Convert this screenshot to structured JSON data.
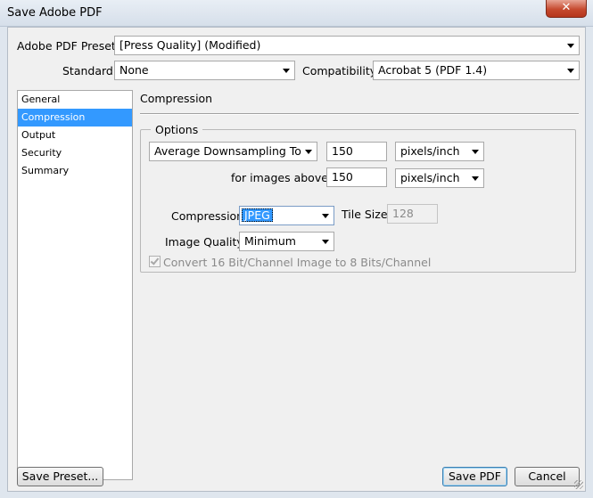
{
  "window": {
    "title": "Save Adobe PDF",
    "close_glyph": "✕"
  },
  "preset": {
    "label": "Adobe PDF Preset:",
    "value": "[Press Quality] (Modified)"
  },
  "standard": {
    "label": "Standard:",
    "value": "None"
  },
  "compatibility": {
    "label": "Compatibility:",
    "value": "Acrobat 5 (PDF 1.4)"
  },
  "sidebar": {
    "items": [
      {
        "label": "General",
        "selected": false
      },
      {
        "label": "Compression",
        "selected": true
      },
      {
        "label": "Output",
        "selected": false
      },
      {
        "label": "Security",
        "selected": false
      },
      {
        "label": "Summary",
        "selected": false
      }
    ]
  },
  "section": {
    "title": "Compression"
  },
  "options": {
    "legend": "Options",
    "downsampling": {
      "value": "Average Downsampling To"
    },
    "resolution": {
      "value": "150",
      "unit": "pixels/inch"
    },
    "above": {
      "label": "for images above:",
      "value": "150",
      "unit": "pixels/inch"
    },
    "compression": {
      "label": "Compression:",
      "value": "JPEG"
    },
    "tile_size": {
      "label": "Tile Size:",
      "value": "128"
    },
    "image_quality": {
      "label": "Image Quality:",
      "value": "Minimum"
    },
    "convert": {
      "label": "Convert 16 Bit/Channel Image to 8 Bits/Channel",
      "checked": true
    }
  },
  "buttons": {
    "save_preset": "Save Preset...",
    "save_pdf": "Save PDF",
    "cancel": "Cancel"
  },
  "colors": {
    "selection": "#3399ff",
    "client_bg": "#f0f0f0"
  }
}
